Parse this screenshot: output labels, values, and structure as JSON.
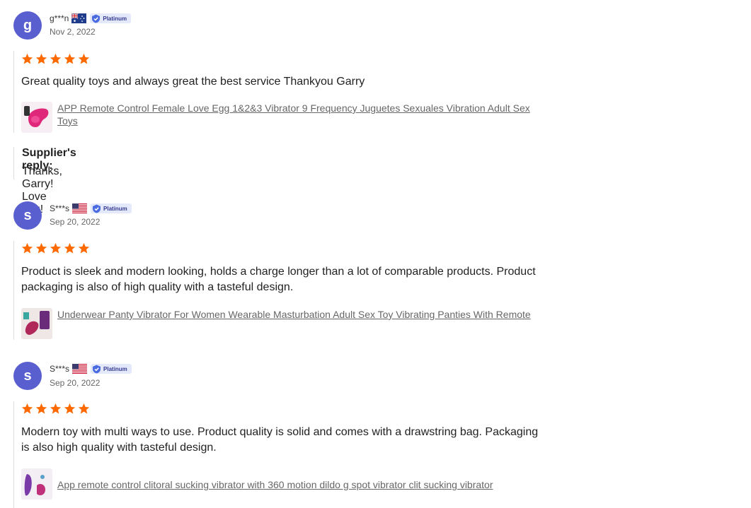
{
  "colors": {
    "star": "#ff6a00",
    "avatar": "#5a5fcf",
    "badge_bg": "#e4e8fb",
    "link": "#666666"
  },
  "reviews": [
    {
      "avatar_letter": "g",
      "username": "g***n",
      "country_flag": "australia-flag-icon",
      "badge": "Platinum",
      "date": "Nov 2, 2022",
      "rating": 5,
      "text": "Great quality toys and always great the best service Thankyou Garry",
      "product_title": "APP Remote Control Female Love Egg 1&2&3 Vibrator 9 Frequency Juguetes Sexuales Vibration Adult Sex Toys",
      "supplier_reply_label": "Supplier's reply:",
      "supplier_reply": "Thanks, Garry! Love you!"
    },
    {
      "avatar_letter": "s",
      "username": "S***s",
      "country_flag": "usa-flag-icon",
      "badge": "Platinum",
      "date": "Sep 20, 2022",
      "rating": 5,
      "text": "Product is sleek and modern looking, holds a charge longer than a lot of comparable products. Product packaging is also of high quality with a tasteful design.",
      "product_title": "Underwear Panty Vibrator For Women Wearable Masturbation Adult Sex Toy Vibrating Panties With Remote"
    },
    {
      "avatar_letter": "s",
      "username": "S***s",
      "country_flag": "usa-flag-icon",
      "badge": "Platinum",
      "date": "Sep 20, 2022",
      "rating": 5,
      "text": "Modern toy with multi ways to use. Product quality is solid and comes with a drawstring bag. Packaging is also high quality with tasteful design.",
      "product_title": "App remote control clitoral sucking vibrator with 360 motion dildo g spot vibrator clit sucking vibrator"
    }
  ]
}
